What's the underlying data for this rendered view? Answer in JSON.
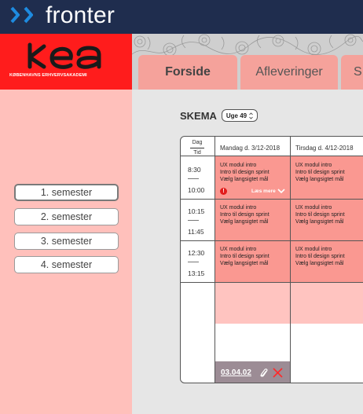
{
  "topbar": {
    "brand": "fronter",
    "logo_icon": "double-chevron-right-icon"
  },
  "kea": {
    "wordmark": "KEA",
    "subtitle": "KØBENHAVNS ERHVERVSAKADEMI"
  },
  "tabs": [
    {
      "label": "Forside"
    },
    {
      "label": "Afleveringer"
    },
    {
      "label": "S"
    }
  ],
  "sidebar": {
    "semesters": [
      {
        "label": "1. semester",
        "active": true
      },
      {
        "label": "2. semester",
        "active": false
      },
      {
        "label": "3. semester",
        "active": false
      },
      {
        "label": "4. semester",
        "active": false
      }
    ]
  },
  "schedule": {
    "title": "SKEMA",
    "week": "Uge 49",
    "week_icon": "up-down-arrow-icon",
    "corner": {
      "top": "Dag",
      "bottom": "Tid"
    },
    "days": [
      "Mandag d. 3/12-2018",
      "Tirsdag d. 4/12-2018"
    ],
    "slots": [
      {
        "start": "8:30",
        "end": "10:00"
      },
      {
        "start": "10:15",
        "end": "11:45"
      },
      {
        "start": "12:30",
        "end": "13:15"
      }
    ],
    "event_lines": [
      "UX modul intro",
      "Intro til design sprint",
      "Vælg langsigtet mål"
    ],
    "read_more": "Læs mere",
    "warning_icon": "exclamation-circle-icon",
    "room": "03.04.02",
    "room_icons": [
      "paperclip-icon",
      "close-x-icon"
    ],
    "colors": {
      "event": "#fa9891",
      "event_light": "#ffc4c0",
      "accent_red": "#ff1c1c",
      "topbar": "#1f2d4e"
    }
  }
}
